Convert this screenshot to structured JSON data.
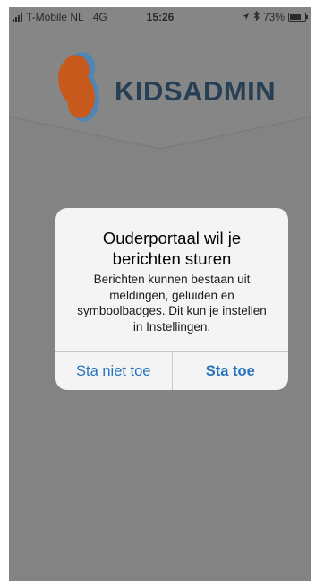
{
  "status_bar": {
    "carrier": "T-Mobile NL",
    "network": "4G",
    "time": "15:26",
    "battery_percent": "73%",
    "battery_level": 0.73,
    "location_icon": "location-arrow-icon",
    "bluetooth_icon": "bluetooth-icon"
  },
  "app": {
    "logo_text": "KIDSADMIN",
    "brand_color": "#263f55",
    "logo_colors": [
      "#c6591b",
      "#4f86b6"
    ]
  },
  "alert": {
    "title": "Ouderportaal wil je berichten sturen",
    "message": "Berichten kunnen bestaan uit meldingen, geluiden en symboolbadges. Dit kun je instellen in Instellingen.",
    "deny_label": "Sta niet toe",
    "allow_label": "Sta toe",
    "button_color": "#2674c0"
  }
}
